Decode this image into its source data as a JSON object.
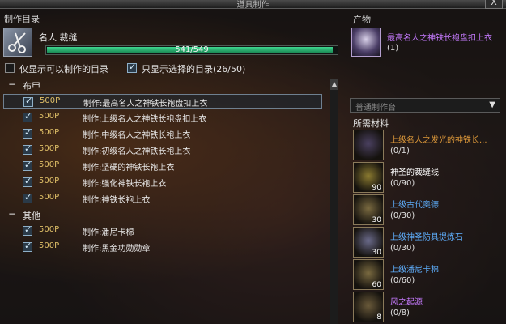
{
  "window": {
    "title": "道具制作",
    "close_label": "X"
  },
  "left": {
    "section_title": "制作目录",
    "skill_name": "名人 裁缝",
    "progress": {
      "text": "541/549",
      "fraction": 0.985
    },
    "filters": [
      {
        "label": "仅显示可以制作的目录",
        "checked": false
      },
      {
        "label": "只显示选择的目录(26/50)",
        "checked": true
      }
    ],
    "categories": [
      {
        "label": "布甲",
        "toggle": "−",
        "items": [
          {
            "cost": "500P",
            "name": "制作:最高名人之神铁长袍盘扣上衣",
            "selected": true
          },
          {
            "cost": "500P",
            "name": "制作:上级名人之神铁长袍盘扣上衣"
          },
          {
            "cost": "500P",
            "name": "制作:中级名人之神铁长袍上衣"
          },
          {
            "cost": "500P",
            "name": "制作:初级名人之神铁长袍上衣"
          },
          {
            "cost": "500P",
            "name": "制作:坚硬的神铁长袍上衣"
          },
          {
            "cost": "500P",
            "name": "制作:强化神铁长袍上衣"
          },
          {
            "cost": "500P",
            "name": "制作:神铁长袍上衣"
          }
        ]
      },
      {
        "label": "其他",
        "toggle": "−",
        "items": [
          {
            "cost": "500P",
            "name": "制作:潘尼卡棉"
          },
          {
            "cost": "500P",
            "name": "制作:黑金功勋勋章"
          }
        ]
      }
    ]
  },
  "right": {
    "product_title": "产物",
    "product_name": "最高名人之神铁长袍盘扣上衣",
    "product_count": "(1)",
    "workbench": "普通制作台",
    "materials_title": "所需材料",
    "materials": [
      {
        "name": "上级名人之发光的神铁长...",
        "count": "(0/1)",
        "qty": "",
        "color": "#e09a3a",
        "icon_color": "#4a4060"
      },
      {
        "name": "神圣的裁缝线",
        "count": "(0/90)",
        "qty": "90",
        "color": "#ffffff",
        "icon_color": "#8a7a30"
      },
      {
        "name": "上级古代奥德",
        "count": "(0/30)",
        "qty": "30",
        "color": "#5fb0ff",
        "icon_color": "#7a6a40"
      },
      {
        "name": "上级神圣防具提炼石",
        "count": "(0/30)",
        "qty": "30",
        "color": "#5fb0ff",
        "icon_color": "#6a6a8a"
      },
      {
        "name": "上级潘尼卡棉",
        "count": "(0/60)",
        "qty": "60",
        "color": "#5fb0ff",
        "icon_color": "#7a6a40"
      },
      {
        "name": "风之起源",
        "count": "(0/8)",
        "qty": "8",
        "color": "#c77bff",
        "icon_color": "#6a5a3a"
      }
    ]
  }
}
